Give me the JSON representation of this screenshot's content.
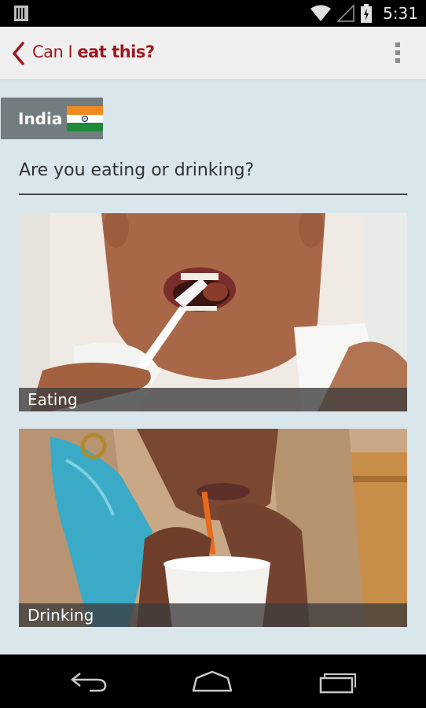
{
  "status_bar": {
    "time": "5:31",
    "icons": [
      "sim-card-icon",
      "wifi-icon",
      "signal-icon",
      "battery-charging-icon"
    ]
  },
  "app_bar": {
    "title_plain": "Can I ",
    "title_bold": "eat this?",
    "back_icon": "chevron-left-icon",
    "overflow_icon": "overflow-menu-icon",
    "accent_color": "#9a1b20"
  },
  "country": {
    "name": "India",
    "flag_icon": "india-flag-icon"
  },
  "question": "Are you eating or drinking?",
  "choices": [
    {
      "label": "Eating",
      "image": "child-eating-with-fork"
    },
    {
      "label": "Drinking",
      "image": "woman-drinking-through-straw"
    }
  ],
  "nav_bar": {
    "icons": [
      "back-icon",
      "home-icon",
      "recent-apps-icon"
    ]
  }
}
